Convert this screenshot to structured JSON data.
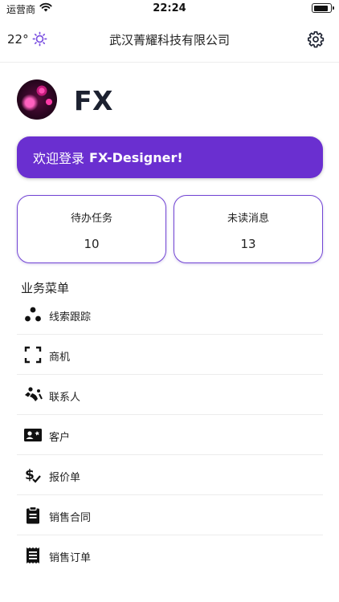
{
  "status_bar": {
    "carrier": "运营商",
    "time": "22:24"
  },
  "nav": {
    "temperature": "22°",
    "title": "武汉菁耀科技有限公司",
    "icons": [
      "sun-icon",
      "gear-icon"
    ]
  },
  "profile": {
    "username": "FX"
  },
  "welcome": {
    "prefix": "欢迎登录",
    "brand": "FX-Designer!"
  },
  "stats": [
    {
      "label": "待办任务",
      "value": "10"
    },
    {
      "label": "未读消息",
      "value": "13"
    }
  ],
  "menu": {
    "title": "业务菜单",
    "items": [
      {
        "label": "线索跟踪",
        "icon": "dots-icon"
      },
      {
        "label": "商机",
        "icon": "focus-frame-icon"
      },
      {
        "label": "联系人",
        "icon": "contacts-icon"
      },
      {
        "label": "客户",
        "icon": "id-card-icon"
      },
      {
        "label": "报价单",
        "icon": "dollar-check-icon"
      },
      {
        "label": "销售合同",
        "icon": "clipboard-icon"
      },
      {
        "label": "销售订单",
        "icon": "receipt-icon"
      }
    ]
  },
  "colors": {
    "accent": "#6a2fd0",
    "card_border": "#7346d4",
    "text": "#1b1f2a"
  }
}
